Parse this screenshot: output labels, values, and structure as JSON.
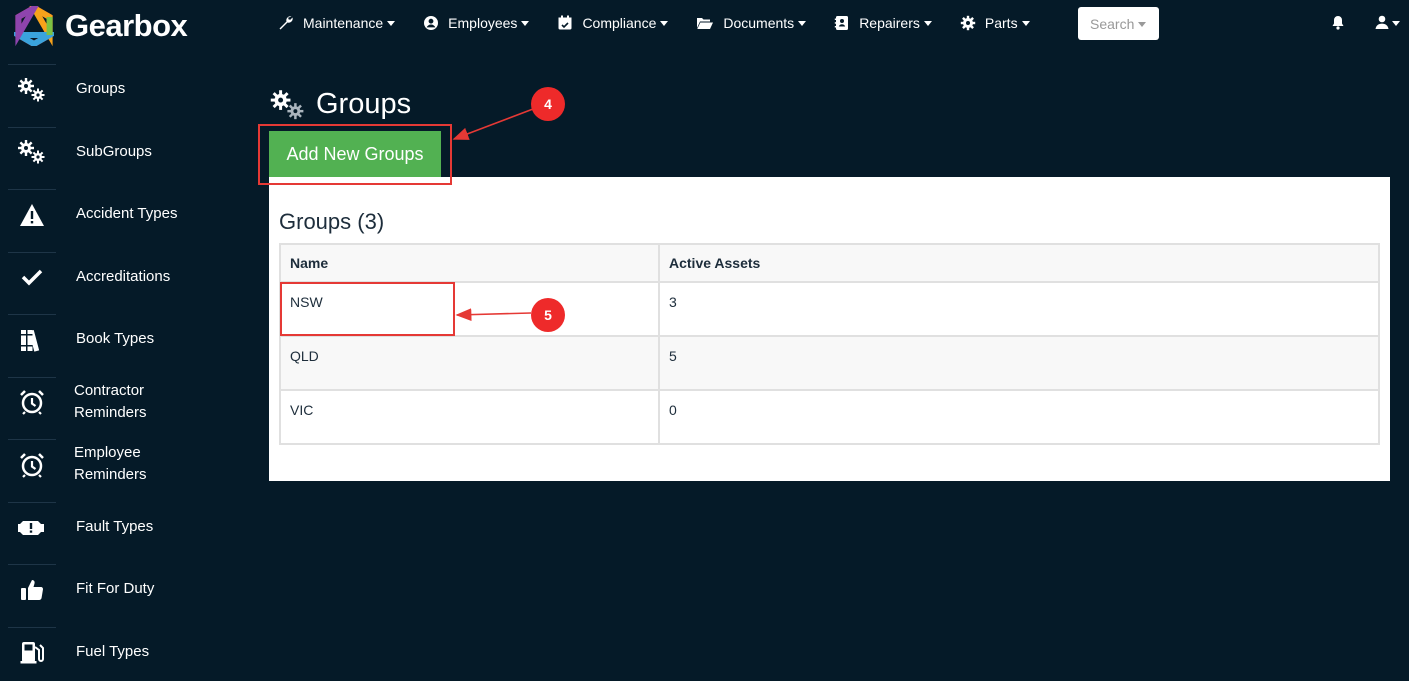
{
  "brand": {
    "name": "Gearbox"
  },
  "nav": [
    {
      "label": "Maintenance",
      "icon": "wrench-icon"
    },
    {
      "label": "Employees",
      "icon": "user-circle-icon"
    },
    {
      "label": "Compliance",
      "icon": "calendar-check-icon"
    },
    {
      "label": "Documents",
      "icon": "folder-open-icon"
    },
    {
      "label": "Repairers",
      "icon": "address-book-icon"
    },
    {
      "label": "Parts",
      "icon": "gear-icon"
    }
  ],
  "search": {
    "label": "Search"
  },
  "sidebar": {
    "items": [
      {
        "label": "Groups",
        "icon": "cogs-icon"
      },
      {
        "label": "SubGroups",
        "icon": "cogs-icon"
      },
      {
        "label": "Accident Types",
        "icon": "warning-icon"
      },
      {
        "label": "Accreditations",
        "icon": "check-icon"
      },
      {
        "label": "Book Types",
        "icon": "books-icon"
      },
      {
        "label": "Contractor Reminders",
        "line1": "Contractor",
        "line2": "Reminders",
        "icon": "alarm-clock-icon"
      },
      {
        "label": "Employee Reminders",
        "line1": "Employee",
        "line2": "Reminders",
        "icon": "alarm-clock-icon"
      },
      {
        "label": "Fault Types",
        "icon": "engine-warning-icon"
      },
      {
        "label": "Fit For Duty",
        "icon": "thumbs-up-icon"
      },
      {
        "label": "Fuel Types",
        "icon": "gas-pump-icon"
      }
    ]
  },
  "page": {
    "title": "Groups",
    "add_button": "Add New Groups",
    "panel_title": "Groups (3)",
    "columns": [
      "Name",
      "Active Assets"
    ],
    "rows": [
      {
        "name": "NSW",
        "active_assets": "3"
      },
      {
        "name": "QLD",
        "active_assets": "5"
      },
      {
        "name": "VIC",
        "active_assets": "0"
      }
    ]
  },
  "annotations": [
    {
      "number": "4",
      "color": "#ee2a2a"
    },
    {
      "number": "5",
      "color": "#ee2a2a"
    }
  ],
  "colors": {
    "background": "#051a28",
    "accent_green": "#52b152",
    "annotation_red": "#ee2a2a"
  }
}
